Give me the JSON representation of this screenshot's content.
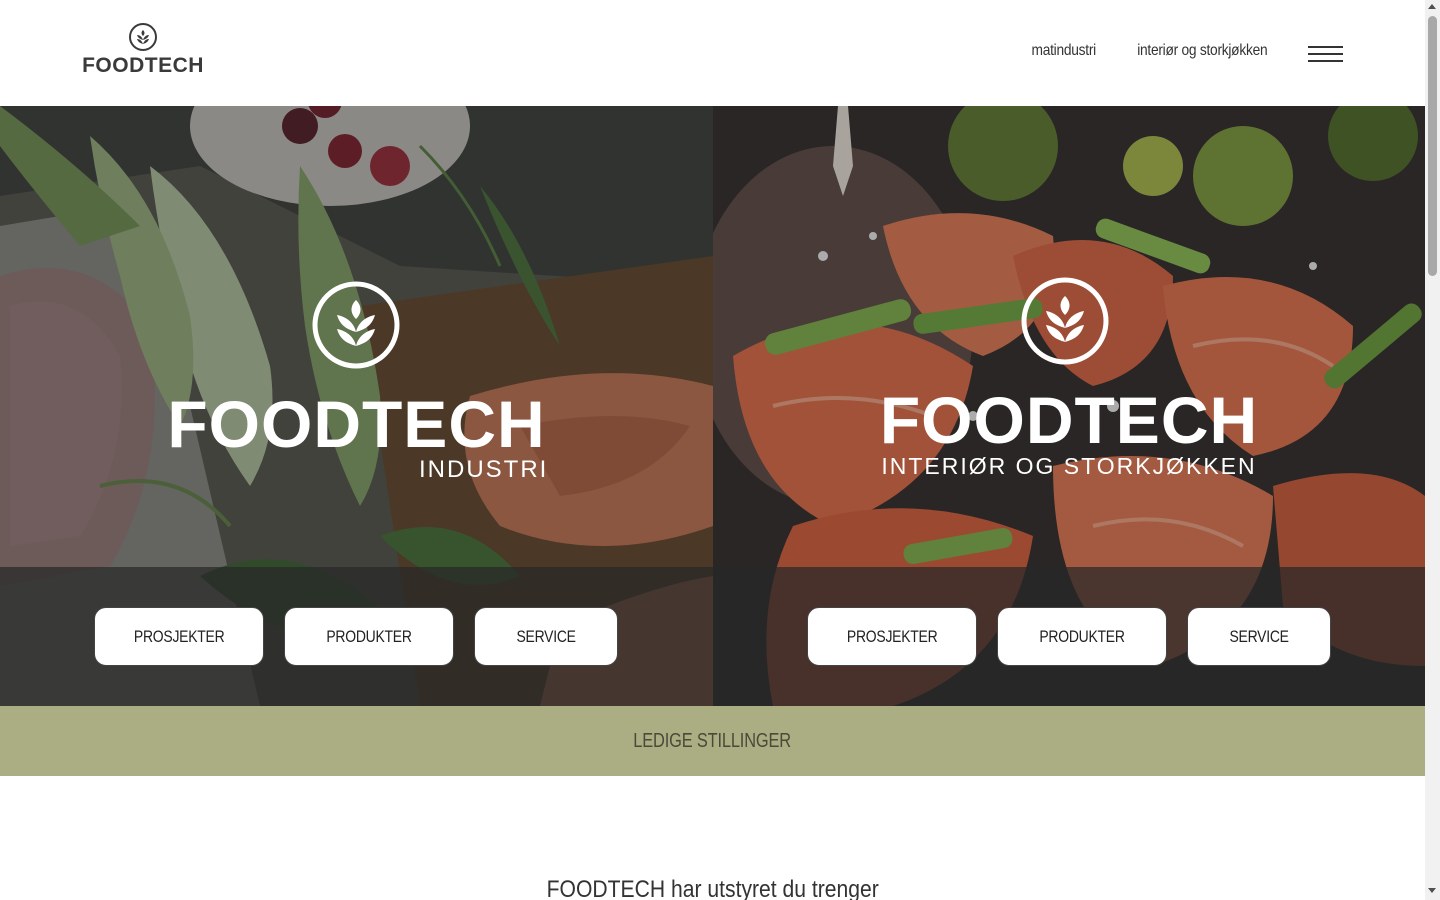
{
  "header": {
    "logo_text": "FOODTECH",
    "nav": [
      {
        "label": "matindustri"
      },
      {
        "label": "interiør og storkjøkken"
      }
    ]
  },
  "panels": [
    {
      "brand_name": "FOODTECH",
      "brand_sub": "INDUSTRI",
      "buttons": [
        "PROSJEKTER",
        "PRODUKTER",
        "SERVICE"
      ]
    },
    {
      "brand_name": "FOODTECH",
      "brand_sub": "INTERIØR OG STORKJØKKEN",
      "buttons": [
        "PROSJEKTER",
        "PRODUKTER",
        "SERVICE"
      ]
    }
  ],
  "jobs_bar": {
    "label": "LEDIGE STILLINGER",
    "color": "#abad83"
  },
  "intro": {
    "heading": "FOODTECH har utstyret du trenger"
  }
}
